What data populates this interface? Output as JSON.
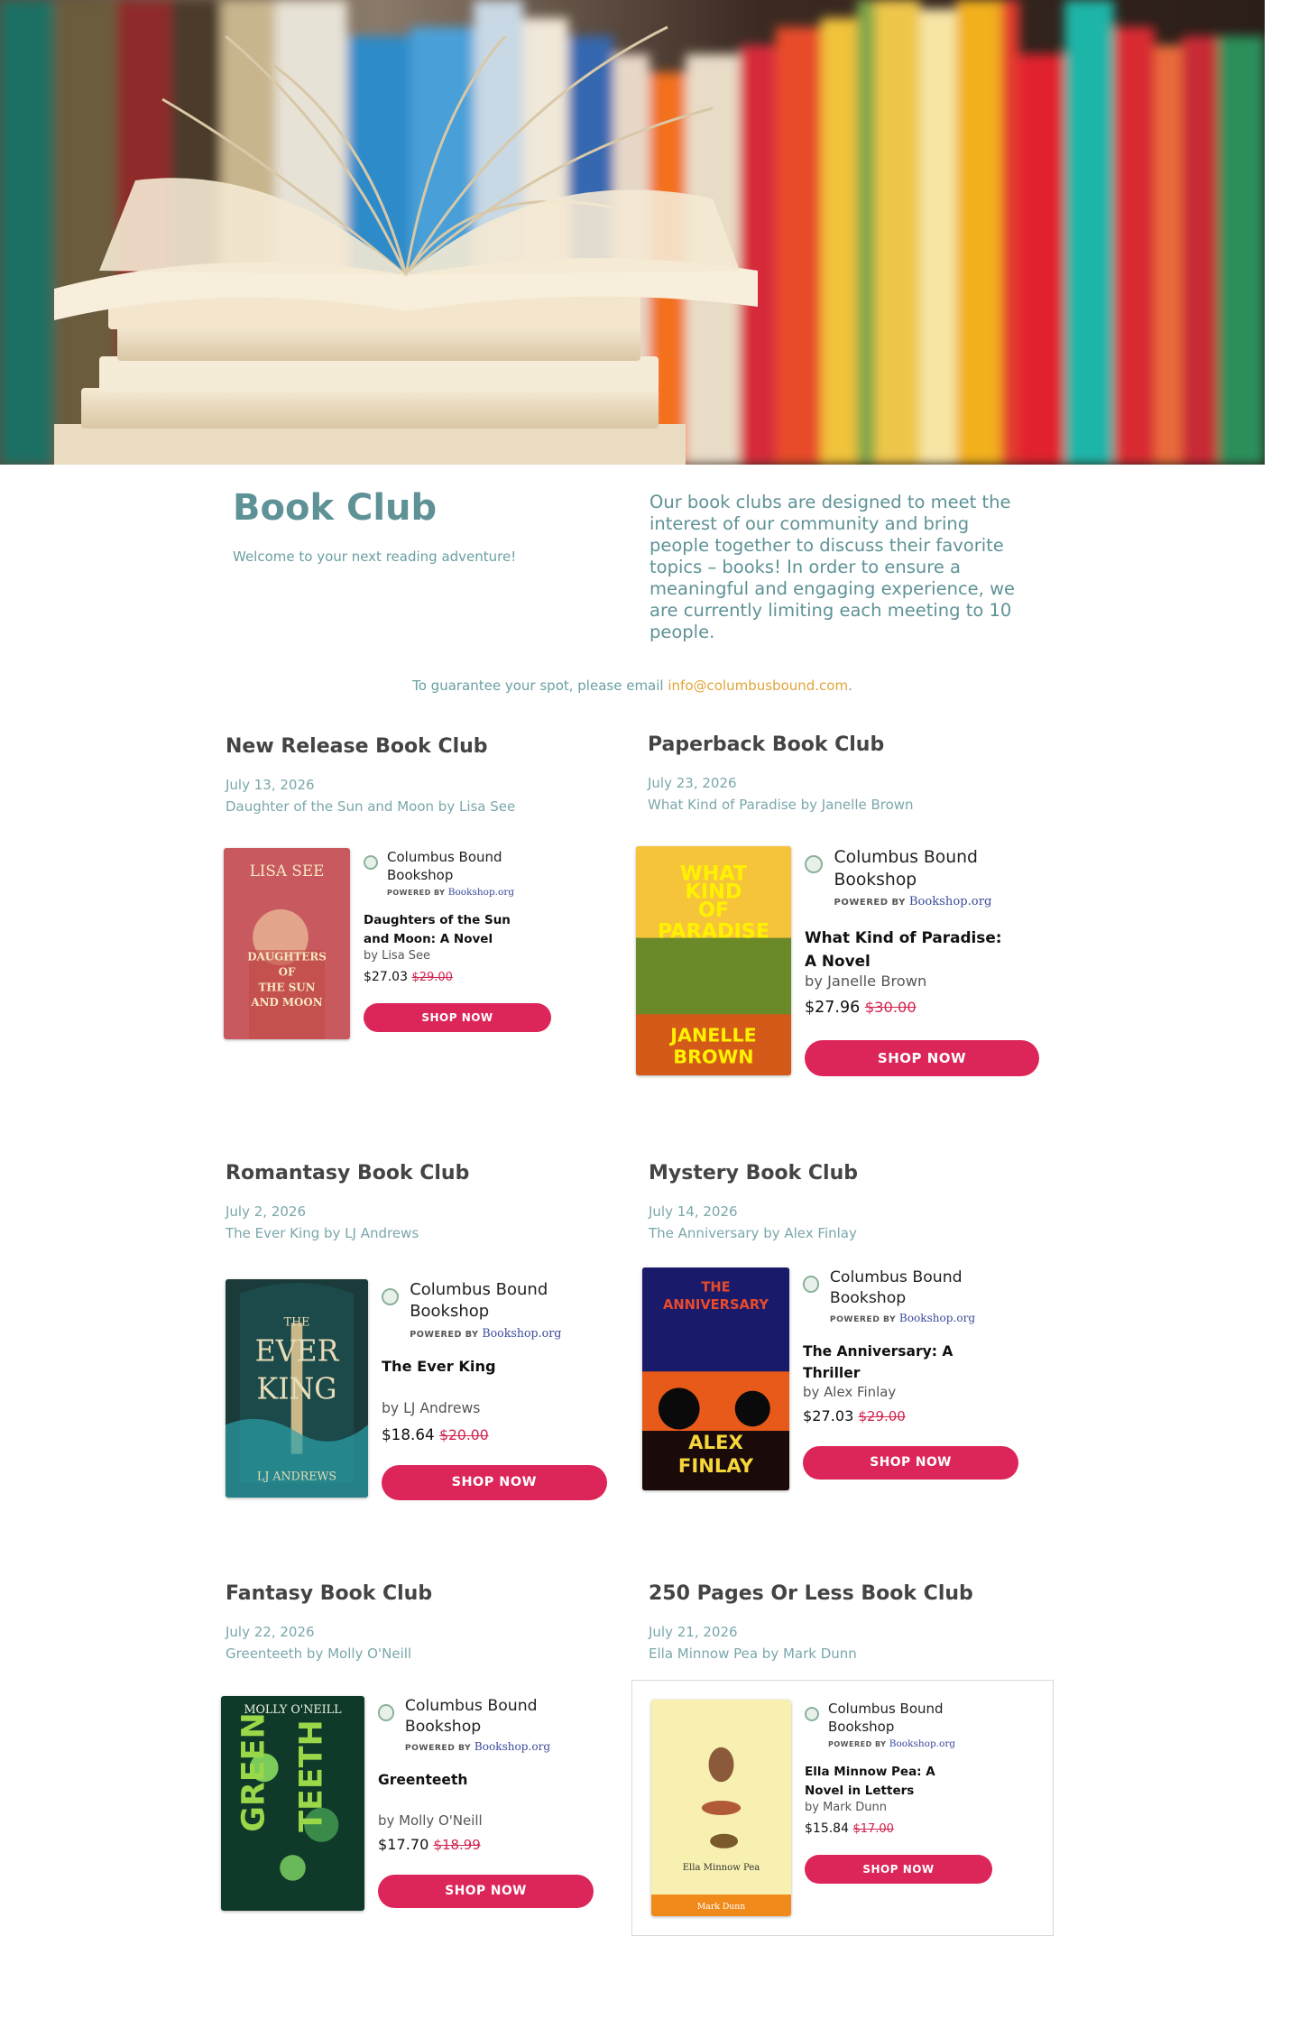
{
  "page": {
    "title": "Book Club",
    "welcome": "Welcome to your next reading adventure!",
    "intro": "Our book clubs are designed to meet the interest of our community and bring people together to discuss their favorite topics – books! In order to ensure a meaningful and engaging experience, we are currently limiting each meeting to 10 people.",
    "guarantee_prefix": "To guarantee your spot, please email ",
    "guarantee_email": "info@columbusbound.com",
    "guarantee_suffix": "."
  },
  "widget_common": {
    "store_name": "Columbus Bound Bookshop",
    "powered_by": "POWERED BY",
    "bookshop": "Bookshop.org",
    "shop_label": "SHOP NOW"
  },
  "clubs": [
    {
      "name": "New Release Book Club",
      "date": "July 13, 2026",
      "book_line": "Daughter of the Sun and Moon by Lisa See",
      "book_title": "Daughters of the Sun and Moon: A Novel",
      "author": "by Lisa See",
      "price": "$27.03",
      "old_price": "$29.00",
      "cover_author": "LISA SEE",
      "cover_title": "DAUGHTERS OF THE SUN AND MOON"
    },
    {
      "name": "Paperback Book Club",
      "date": "July 23, 2026",
      "book_line": "What Kind of Paradise by Janelle Brown",
      "book_title": "What Kind of Paradise: A Novel",
      "author": "by Janelle Brown",
      "price": "$27.96",
      "old_price": "$30.00",
      "cover_title": "WHAT KIND OF PARADISE",
      "cover_author": "JANELLE BROWN"
    },
    {
      "name": "Romantasy Book Club",
      "date": "July 2, 2026",
      "book_line": "The Ever King by LJ Andrews",
      "book_title": "The Ever King",
      "author": "by LJ Andrews",
      "price": "$18.64",
      "old_price": "$20.00",
      "cover_title": "THE EVER KING",
      "cover_author": "LJ ANDREWS"
    },
    {
      "name": "Mystery Book Club",
      "date": "July 14, 2026",
      "book_line": "The Anniversary by Alex Finlay",
      "book_title": "The Anniversary: A Thriller",
      "author": "by Alex Finlay",
      "price": "$27.03",
      "old_price": "$29.00",
      "cover_title": "THE ANNIVERSARY",
      "cover_author": "ALEX FINLAY"
    },
    {
      "name": "Fantasy Book Club",
      "date": "July 22, 2026",
      "book_line": "Greenteeth by Molly O'Neill",
      "book_title": "Greenteeth",
      "author": "by Molly O'Neill",
      "price": "$17.70",
      "old_price": "$18.99",
      "cover_title": "GREENTEETH",
      "cover_author": "MOLLY O'NEILL"
    },
    {
      "name": "250 Pages Or Less Book Club",
      "date": "July 21, 2026",
      "book_line": "Ella Minnow Pea by Mark Dunn",
      "book_title": "Ella Minnow Pea: A Novel in Letters",
      "author": "by Mark Dunn",
      "price": "$15.84",
      "old_price": "$17.00",
      "cover_title": "Ella Minnow Pea",
      "cover_author": "Mark Dunn"
    }
  ]
}
